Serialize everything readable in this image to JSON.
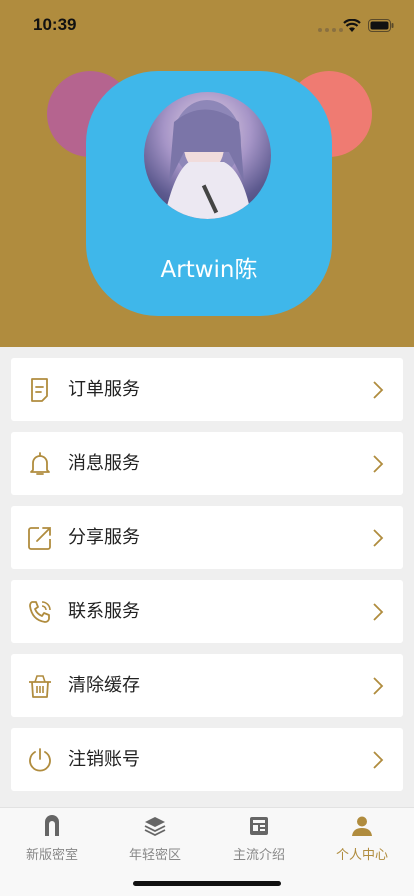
{
  "status_bar": {
    "time": "10:39"
  },
  "profile": {
    "username": "Artwin陈",
    "colors": {
      "header_bg": "#b08c3e",
      "face": "#3fb7ea",
      "ear_left": "#b5648f",
      "ear_right": "#ef7b72"
    }
  },
  "menu": {
    "items": [
      {
        "label": "订单服务",
        "icon": "document-icon"
      },
      {
        "label": "消息服务",
        "icon": "bell-icon"
      },
      {
        "label": "分享服务",
        "icon": "share-icon"
      },
      {
        "label": "联系服务",
        "icon": "phone-icon"
      },
      {
        "label": "清除缓存",
        "icon": "trash-icon"
      },
      {
        "label": "注销账号",
        "icon": "power-icon"
      }
    ]
  },
  "tabbar": {
    "accent": "#b08c3e",
    "tabs": [
      {
        "label": "新版密室",
        "icon": "door-icon"
      },
      {
        "label": "年轻密区",
        "icon": "layers-icon"
      },
      {
        "label": "主流介绍",
        "icon": "newspaper-icon"
      },
      {
        "label": "个人中心",
        "icon": "person-icon",
        "active": true
      }
    ]
  }
}
